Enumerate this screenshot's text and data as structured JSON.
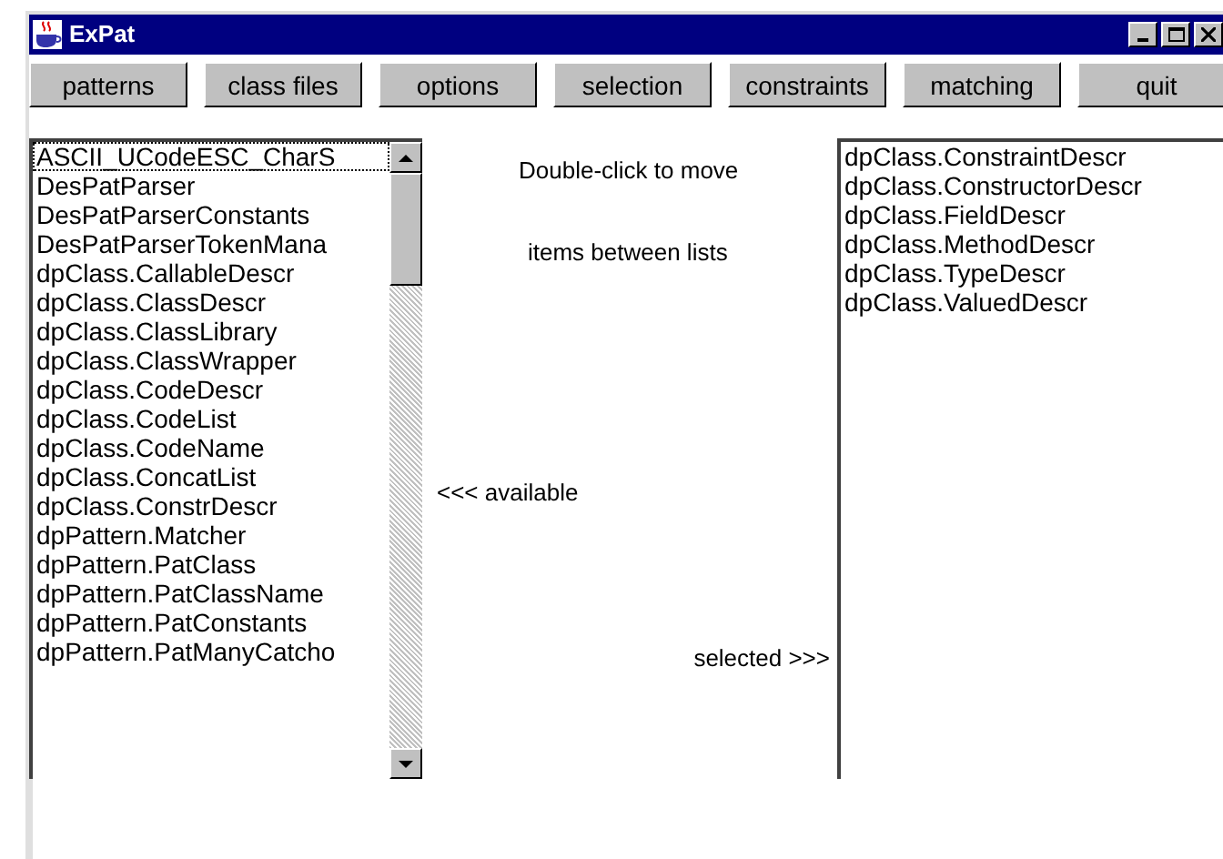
{
  "window": {
    "title": "ExPat"
  },
  "toolbar": [
    "patterns",
    "class files",
    "options",
    "selection",
    "constraints",
    "matching",
    "quit"
  ],
  "available_list": {
    "items": [
      {
        "label": "ASCII_UCodeESC_CharS",
        "selected": true
      },
      {
        "label": "DesPatParser",
        "selected": false
      },
      {
        "label": "DesPatParserConstants",
        "selected": false
      },
      {
        "label": "DesPatParserTokenMana",
        "selected": false
      },
      {
        "label": "dpClass.CallableDescr",
        "selected": false
      },
      {
        "label": "dpClass.ClassDescr",
        "selected": false
      },
      {
        "label": "dpClass.ClassLibrary",
        "selected": false
      },
      {
        "label": "dpClass.ClassWrapper",
        "selected": false
      },
      {
        "label": "dpClass.CodeDescr",
        "selected": false
      },
      {
        "label": "dpClass.CodeList",
        "selected": false
      },
      {
        "label": "dpClass.CodeName",
        "selected": false
      },
      {
        "label": "dpClass.ConcatList",
        "selected": false
      },
      {
        "label": "dpClass.ConstrDescr",
        "selected": false
      },
      {
        "label": "dpPattern.Matcher",
        "selected": false
      },
      {
        "label": "dpPattern.PatClass",
        "selected": false
      },
      {
        "label": "dpPattern.PatClassName",
        "selected": false
      },
      {
        "label": "dpPattern.PatConstants",
        "selected": false
      },
      {
        "label": "dpPattern.PatManyCatcho",
        "selected": false
      }
    ]
  },
  "hint": [
    "Double-click to move",
    "items between lists"
  ],
  "available_label": "<<< available",
  "selected_label": "selected >>>",
  "selected_list": {
    "items": [
      {
        "label": "dpClass.ConstraintDescr",
        "selected": false
      },
      {
        "label": "dpClass.ConstructorDescr",
        "selected": false
      },
      {
        "label": "dpClass.FieldDescr",
        "selected": false
      },
      {
        "label": "dpClass.MethodDescr",
        "selected": false
      },
      {
        "label": "dpClass.TypeDescr",
        "selected": false
      },
      {
        "label": "dpClass.ValuedDescr",
        "selected": false
      }
    ]
  }
}
